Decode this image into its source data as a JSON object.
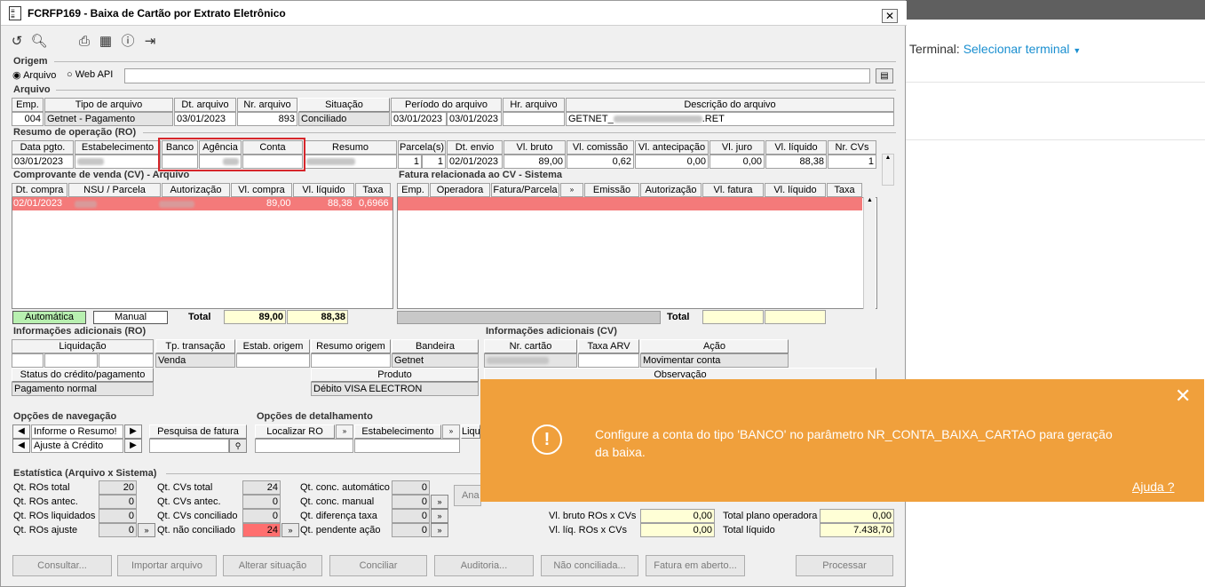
{
  "window": {
    "title": "FCRFP169 - Baixa de Cartão por Extrato Eletrônico",
    "close": "✕"
  },
  "toolbar": {
    "icons": [
      "refresh-icon",
      "search-icon",
      "print-icon",
      "calendar-icon",
      "help-icon",
      "exit-icon"
    ]
  },
  "origem": {
    "title": "Origem",
    "opt_arquivo": "Arquivo",
    "opt_webapi": "Web API",
    "path_value": ""
  },
  "arquivo": {
    "title": "Arquivo",
    "headers": [
      "Emp.",
      "Tipo de arquivo",
      "Dt. arquivo",
      "Nr. arquivo",
      "Situação",
      "Período do arquivo",
      "Hr. arquivo",
      "Descrição do arquivo"
    ],
    "emp": "004",
    "tipo": "Getnet - Pagamento",
    "dt_arquivo": "03/01/2023",
    "nr_arquivo": "893",
    "situacao": "Conciliado",
    "periodo_ini": "03/01/2023",
    "periodo_fim": "03/01/2023",
    "hr_arquivo": "",
    "descricao_pre": "GETNET_",
    "descricao_suf": ".RET"
  },
  "ro": {
    "title": "Resumo de operação (RO)",
    "headers": [
      "Data pgto.",
      "Estabelecimento",
      "Banco",
      "Agência",
      "Conta",
      "Resumo",
      "Parcela(s)",
      "Dt. envio",
      "Vl. bruto",
      "Vl. comissão",
      "Vl. antecipação",
      "Vl. juro",
      "Vl. líquido",
      "Nr. CVs"
    ],
    "data_pgto": "03/01/2023",
    "parcela_a": "1",
    "parcela_b": "1",
    "dt_envio": "02/01/2023",
    "vl_bruto": "89,00",
    "vl_comissao": "0,62",
    "vl_antecipacao": "0,00",
    "vl_juro": "0,00",
    "vl_liquido": "88,38",
    "nr_cvs": "1"
  },
  "cv": {
    "title": "Comprovante de venda (CV) - Arquivo",
    "headers": [
      "Dt. compra",
      "NSU / Parcela",
      "Autorização",
      "Vl. compra",
      "Vl. líquido",
      "Taxa"
    ],
    "row": {
      "dt_compra": "02/01/2023",
      "vl_compra": "89,00",
      "vl_liquido": "88,38",
      "taxa": "0,6966"
    },
    "automatica": "Automática",
    "manual": "Manual",
    "total_label": "Total",
    "total_compra": "89,00",
    "total_liquido": "88,38"
  },
  "fatura": {
    "title": "Fatura relacionada ao CV - Sistema",
    "headers": [
      "Emp.",
      "Operadora",
      "Fatura/Parcela",
      "",
      "Emissão",
      "Autorização",
      "Vl. fatura",
      "Vl. líquido",
      "Taxa"
    ],
    "total_label": "Total"
  },
  "info_ro": {
    "title": "Informações adicionais (RO)",
    "headers": [
      "Liquidação",
      "Tp. transação",
      "Estab. origem",
      "Resumo origem",
      "Bandeira"
    ],
    "tp_transacao": "Venda",
    "bandeira": "Getnet",
    "status_label": "Status do crédito/pagamento",
    "status_value": "Pagamento normal",
    "produto_label": "Produto",
    "produto_value": "Débito VISA ELECTRON"
  },
  "info_cv": {
    "title": "Informações adicionais (CV)",
    "headers": [
      "Nr. cartão",
      "Taxa ARV",
      "Ação"
    ],
    "acao": "Movimentar conta",
    "observacao_label": "Observação"
  },
  "nav": {
    "title": "Opções de navegação",
    "select1": "Informe o Resumo!",
    "select2": "Ajuste à Crédito",
    "pesquisa_label": "Pesquisa de fatura"
  },
  "detalhe": {
    "title": "Opções de detalhamento",
    "localizar_ro": "Localizar RO",
    "estabelecimento": "Estabelecimento",
    "liq": "Liqu"
  },
  "estat": {
    "title": "Estatística (Arquivo x Sistema)",
    "c1": [
      {
        "label": "Qt. ROs total",
        "value": "20"
      },
      {
        "label": "Qt. ROs antec.",
        "value": "0"
      },
      {
        "label": "Qt. ROs liquidados",
        "value": "0"
      },
      {
        "label": "Qt. ROs ajuste",
        "value": "0"
      }
    ],
    "c2": [
      {
        "label": "Qt. CVs total",
        "value": "24"
      },
      {
        "label": "Qt. CVs antec.",
        "value": "0"
      },
      {
        "label": "Qt. CVs conciliado",
        "value": "0"
      },
      {
        "label": "Qt. não conciliado",
        "value": "24"
      }
    ],
    "c3": [
      {
        "label": "Qt. conc. automático",
        "value": "0"
      },
      {
        "label": "Qt. conc. manual",
        "value": "0"
      },
      {
        "label": "Qt. diferença taxa",
        "value": "0"
      },
      {
        "label": "Qt. pendente ação",
        "value": "0"
      }
    ],
    "ana": "Ana",
    "r1": [
      {
        "label": "Vl. bruto ROs x CVs",
        "value": "0,00"
      },
      {
        "label": "Vl. líq. ROs x CVs",
        "value": "0,00"
      }
    ],
    "r2": [
      {
        "label": "Total plano operadora",
        "value": "0,00"
      },
      {
        "label": "Total líquido",
        "value": "7.438,70"
      }
    ]
  },
  "buttons": [
    "Consultar...",
    "Importar arquivo",
    "Alterar situação",
    "Conciliar",
    "Auditoria...",
    "Não conciliada...",
    "Fatura em aberto...",
    "Processar"
  ],
  "right": {
    "terminal_label": "Terminal:",
    "terminal_link": "Selecionar terminal"
  },
  "toast": {
    "message": "Configure a conta do tipo 'BANCO' no parâmetro NR_CONTA_BAIXA_CARTAO para geração da baixa.",
    "help": "Ajuda ?",
    "close": "✕",
    "icon": "!",
    "bg_color": "#f0a03c"
  },
  "colors": {
    "red_row": "#f47a7a",
    "yellow_cell": "#ffffd6",
    "automatica_bg": "#b8f0b0",
    "link": "#1a8fd0"
  }
}
